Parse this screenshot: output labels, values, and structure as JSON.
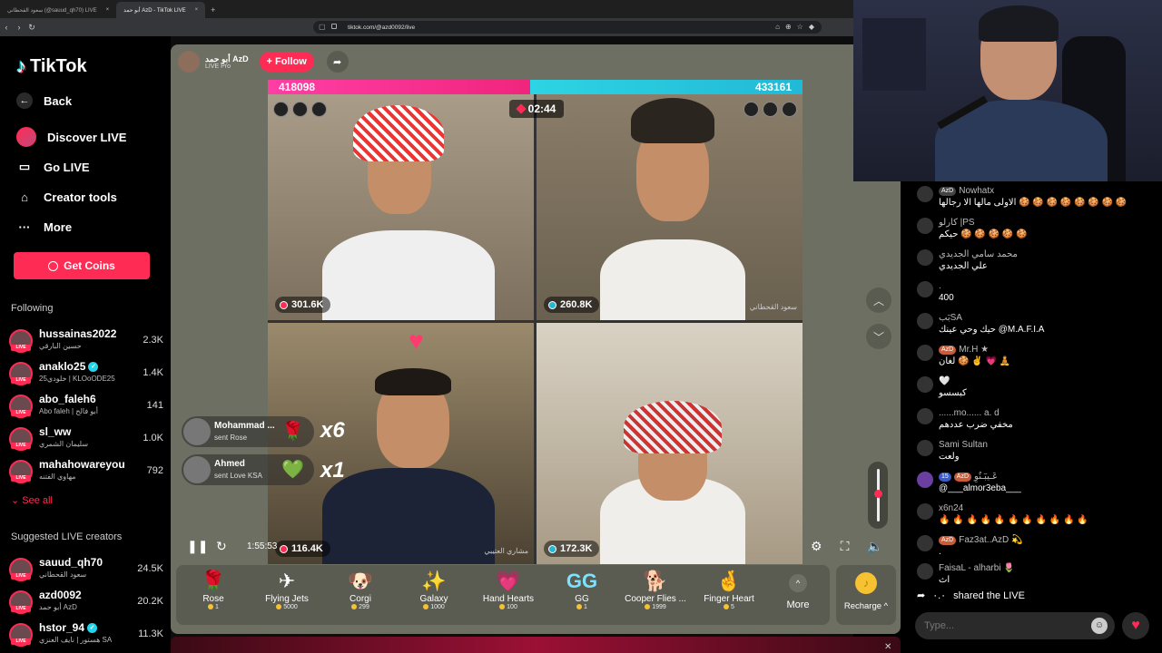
{
  "browser": {
    "tabs": [
      {
        "label": "سعود القحطاني (@sauud_qh70) LIVE",
        "active": false
      },
      {
        "label": "أبو حمد AzD - TikTok LIVE",
        "active": true
      }
    ],
    "url": "tiktok.com/@azd0092/live"
  },
  "sidebar": {
    "logo": "TikTok",
    "nav": [
      {
        "label": "Back",
        "icon": "arrow-left-icon"
      },
      {
        "label": "Discover LIVE",
        "icon": "live-avatar-icon"
      },
      {
        "label": "Go LIVE",
        "icon": "camera-icon"
      },
      {
        "label": "Creator tools",
        "icon": "house-icon"
      },
      {
        "label": "More",
        "icon": "dots-icon"
      }
    ],
    "get_coins": "Get Coins",
    "following_title": "Following",
    "following": [
      {
        "name": "hussainas2022",
        "sub": "حسين البارقي",
        "count": "2.3K",
        "verified": false
      },
      {
        "name": "anaklo25",
        "sub": "خلودي25 | KLOoODE25",
        "count": "1.4K",
        "verified": true
      },
      {
        "name": "abo_faleh6",
        "sub": "Abo faleh | أبو فالح",
        "count": "141",
        "verified": false
      },
      {
        "name": "sl_ww",
        "sub": "سليمان الشمري",
        "count": "1.0K",
        "verified": false
      },
      {
        "name": "mahahowareyou",
        "sub": "مهاوي الفتنه",
        "count": "792",
        "verified": false
      }
    ],
    "see_all": "See all",
    "suggested_title": "Suggested LIVE creators",
    "suggested": [
      {
        "name": "sauud_qh70",
        "sub": "سعود القحطاني",
        "count": "24.5K",
        "verified": false
      },
      {
        "name": "azd0092",
        "sub": "أبو حمد AzD",
        "count": "20.2K",
        "verified": false
      },
      {
        "name": "hstor_94",
        "sub": "هستور | نايف العنزي SA",
        "count": "11.3K",
        "verified": true
      }
    ],
    "live_badge": "LIVE"
  },
  "stream": {
    "host_name": "أبو حمد AzD",
    "host_sub": "LIVE Pro",
    "follow": "+ Follow",
    "score_left": "418098",
    "score_right": "433161",
    "timer": "02:44",
    "cells": [
      {
        "score": "301.6K",
        "name": ""
      },
      {
        "score": "260.8K",
        "name": "سعود القحطاني"
      },
      {
        "score": "116.4K",
        "name": "مشاري العتيبي"
      },
      {
        "score": "172.3K",
        "name": ""
      }
    ],
    "gift_pops": [
      {
        "name": "Mohammad ...",
        "sub": "sent Rose",
        "mult": "x6"
      },
      {
        "name": "Ahmed",
        "sub": "sent Love KSA",
        "mult": "x1"
      }
    ],
    "elapsed": "1:55:53",
    "volume_level": 0.55
  },
  "gifts": [
    {
      "name": "Rose",
      "price": "1",
      "icon": "🌹"
    },
    {
      "name": "Flying Jets",
      "price": "5000",
      "icon": "✈"
    },
    {
      "name": "Corgi",
      "price": "299",
      "icon": "🐶"
    },
    {
      "name": "Galaxy",
      "price": "1000",
      "icon": "✨"
    },
    {
      "name": "Hand Hearts",
      "price": "100",
      "icon": "💗"
    },
    {
      "name": "GG",
      "price": "1",
      "icon": "GG"
    },
    {
      "name": "Cooper Flies ...",
      "price": "1999",
      "icon": "🐕"
    },
    {
      "name": "Finger Heart",
      "price": "5",
      "icon": "🤞"
    }
  ],
  "more_label": "More",
  "recharge_label": "Recharge",
  "chat": [
    {
      "badges": [
        "AzD"
      ],
      "user": "Nowhatx",
      "text": "الاولى مالها الا رجالها 🍪 🍪 🍪 🍪 🍪 🍪 🍪 🍪"
    },
    {
      "badges": [],
      "user": "كارلو |PS",
      "text": "حيكم 🍪 🍪 🍪 🍪 🍪"
    },
    {
      "badges": [],
      "user": "محمد سامي الجديدي",
      "text": "علي الجديدي"
    },
    {
      "badges": [],
      "user": ".",
      "text": "400"
    },
    {
      "badges": [],
      "user": "بَبSA",
      "text": "حيك وحي عينك @M.A.F.I.A"
    },
    {
      "badges": [
        "AzD"
      ],
      "user": "Mr.H ★",
      "text": "لغان 🍪 ✌ 💗 🧘"
    },
    {
      "badges": [],
      "user": "🤍",
      "text": "كبسسو"
    },
    {
      "badges": [],
      "user": "......mo...... a. d",
      "text": "مخفي ضرب عددهم"
    },
    {
      "badges": [],
      "user": "Sami Sultan",
      "text": "ولعت"
    },
    {
      "badges": [
        "15",
        "AzD"
      ],
      "user": "عَـيبٓـنٌوِ",
      "text": "@___almor3eba___"
    },
    {
      "badges": [],
      "user": "x6n24",
      "text": "🔥 🔥 🔥 🔥 🔥 🔥 🔥 🔥 🔥 🔥 🔥"
    },
    {
      "badges": [
        "AzD"
      ],
      "user": "Faz3at..AzD 💫",
      "text": "."
    },
    {
      "badges": [],
      "user": "FaisaL - alharbi 🌷",
      "text": "اث"
    }
  ],
  "shared": {
    "user": "٠.٠",
    "text": "shared the LIVE"
  },
  "chat_placeholder": "Type..."
}
